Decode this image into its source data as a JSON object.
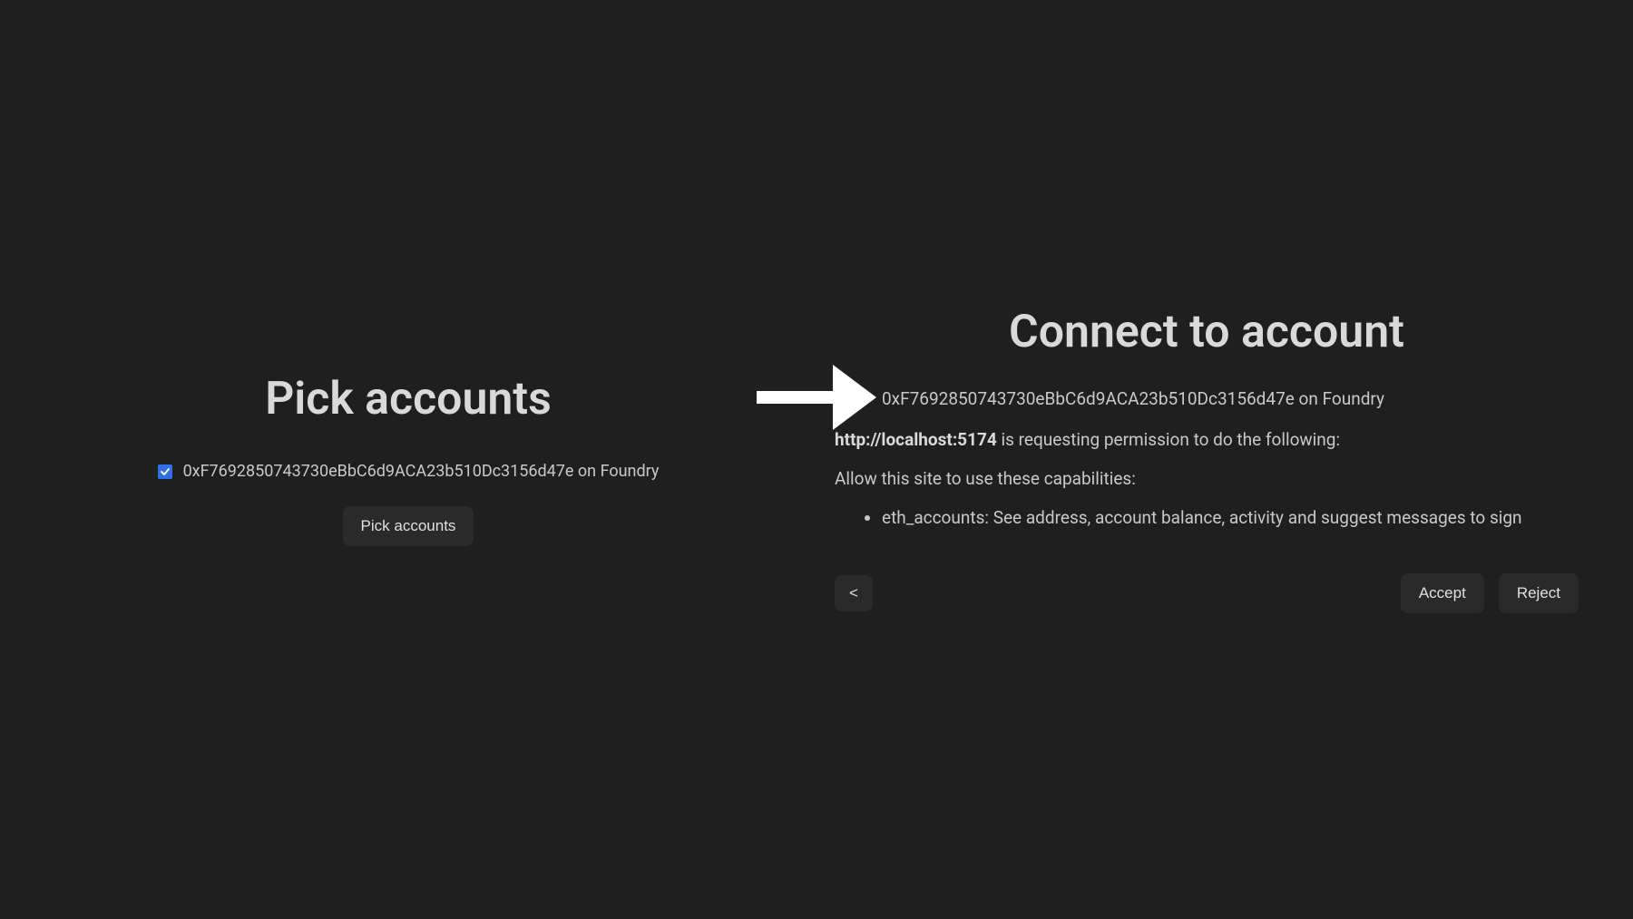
{
  "left": {
    "title": "Pick accounts",
    "account": "0xF7692850743730eBbC6d9ACA23b510Dc3156d47e on Foundry",
    "pickButton": "Pick accounts"
  },
  "right": {
    "title": "Connect to account",
    "accountItem": "0xF7692850743730eBbC6d9ACA23b510Dc3156d47e on Foundry",
    "requestUrl": "http://localhost:5174",
    "requestSuffix": " is requesting permission to do the following:",
    "allowText": "Allow this site to use these capabilities:",
    "capability": "eth_accounts: See address, account balance, activity and suggest messages to sign",
    "backLabel": "<",
    "acceptLabel": "Accept",
    "rejectLabel": "Reject"
  }
}
